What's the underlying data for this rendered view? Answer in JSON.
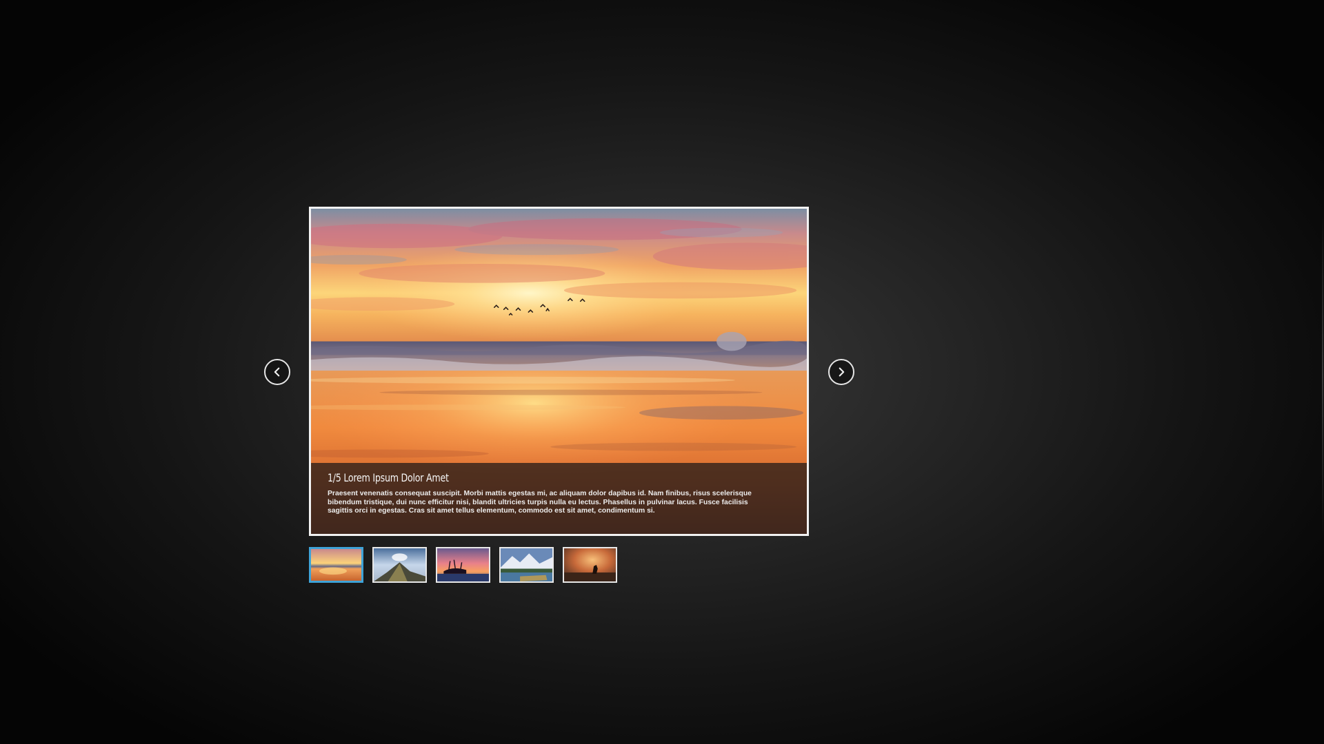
{
  "slider": {
    "counter": "1/5",
    "title": "Lorem Ipsum Dolor Amet",
    "title_full": "1/5 Lorem Ipsum Dolor Amet",
    "description": "Praesent venenatis consequat suscipit. Morbi mattis egestas mi, ac aliquam dolor dapibus id. Nam finibus, risus scelerisque bibendum tristique, dui nunc efficitur nisi, blandit ultricies turpis nulla eu lectus. Phasellus in pulvinar lacus. Fusce facilisis sagittis orci in egestas. Cras sit amet tellus elementum, commodo est sit amet, condimentum si.",
    "current_index": 1,
    "total": 5
  },
  "navigation": {
    "prev_icon": "chevron-left-icon",
    "next_icon": "chevron-right-icon"
  },
  "thumbnails": [
    {
      "subject": "sunset-beach",
      "active": true
    },
    {
      "subject": "mountain-ridge",
      "active": false
    },
    {
      "subject": "tropical-sunset",
      "active": false
    },
    {
      "subject": "mountain-lake",
      "active": false
    },
    {
      "subject": "sunset-silhouette",
      "active": false
    }
  ],
  "colors": {
    "active_thumb_border": "#3ea3d8",
    "frame_border": "#f2f2f2",
    "background": "#1e1e1e"
  }
}
